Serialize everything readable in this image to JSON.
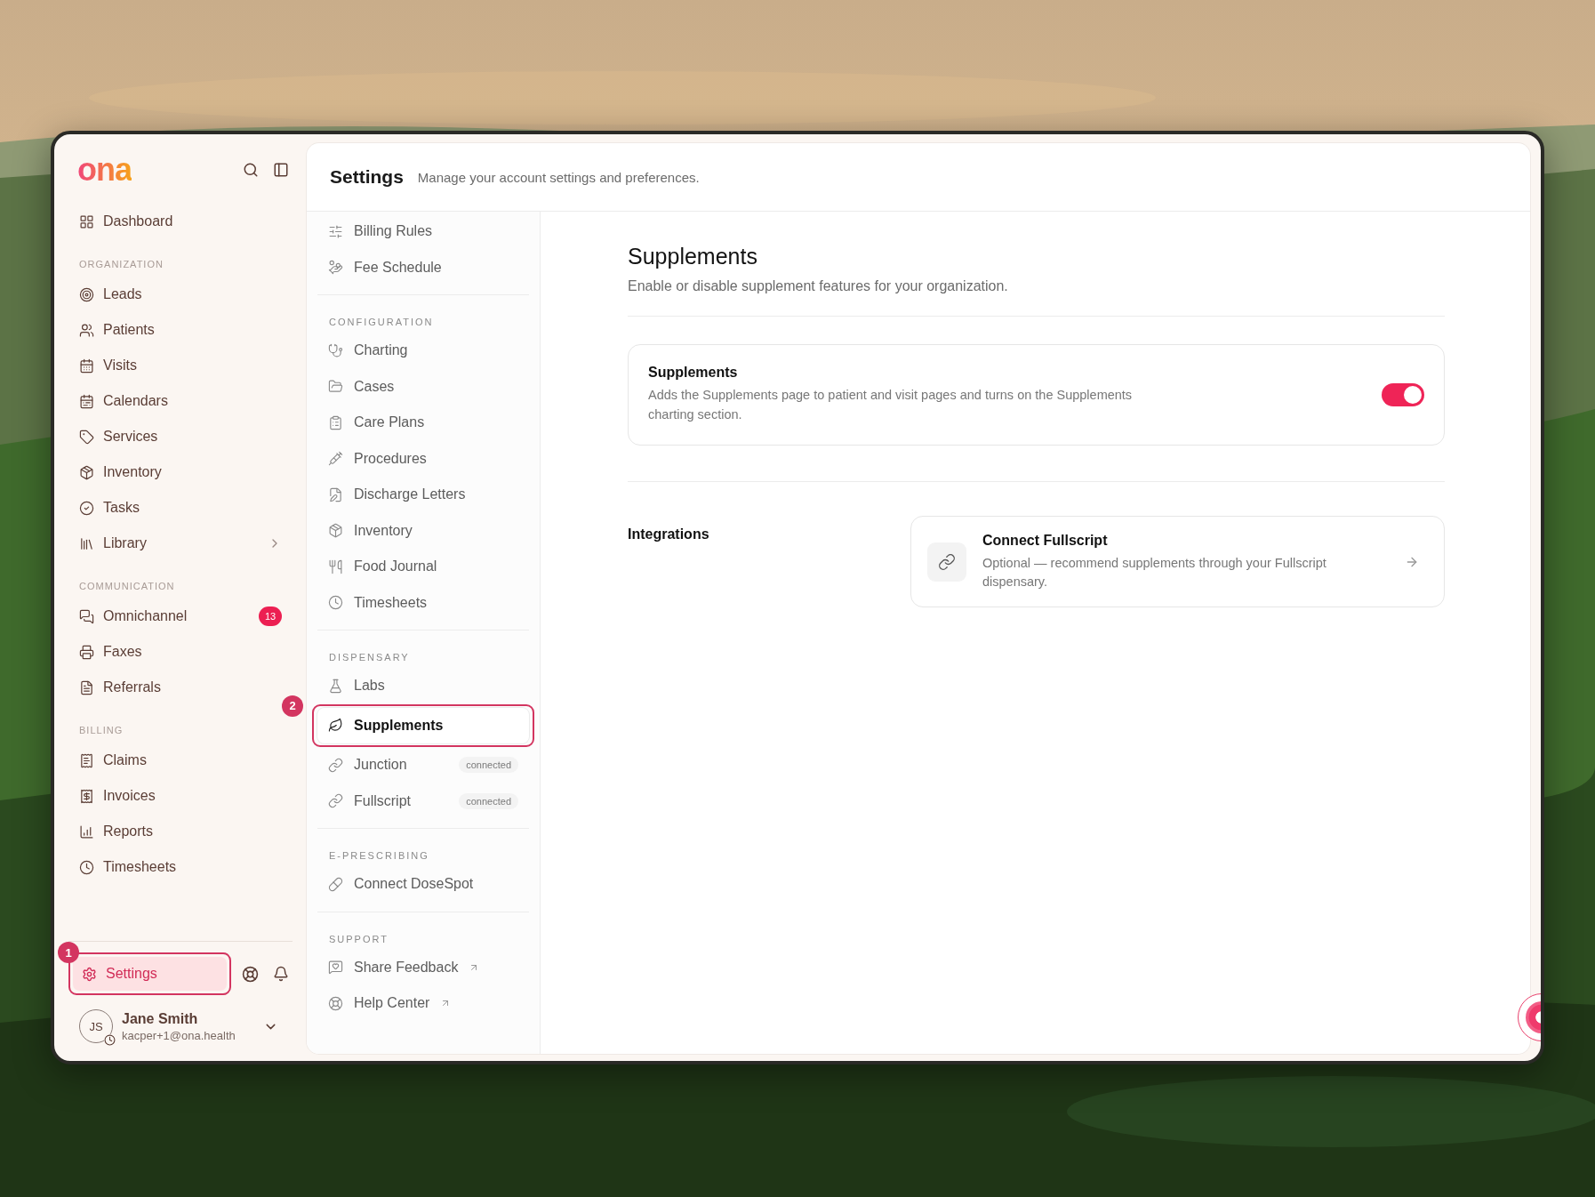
{
  "logo": "ona",
  "sidebar": {
    "top_items": [
      {
        "label": "Dashboard"
      }
    ],
    "sections": [
      {
        "heading": "ORGANIZATION",
        "items": [
          {
            "label": "Leads"
          },
          {
            "label": "Patients"
          },
          {
            "label": "Visits"
          },
          {
            "label": "Calendars"
          },
          {
            "label": "Services"
          },
          {
            "label": "Inventory"
          },
          {
            "label": "Tasks"
          },
          {
            "label": "Library",
            "expandable": true
          }
        ]
      },
      {
        "heading": "COMMUNICATION",
        "items": [
          {
            "label": "Omnichannel",
            "badge": "13"
          },
          {
            "label": "Faxes"
          },
          {
            "label": "Referrals"
          }
        ]
      },
      {
        "heading": "BILLING",
        "items": [
          {
            "label": "Claims"
          },
          {
            "label": "Invoices"
          },
          {
            "label": "Reports"
          },
          {
            "label": "Timesheets"
          }
        ]
      }
    ],
    "settings": {
      "label": "Settings",
      "selected": true,
      "callout": "1"
    },
    "user": {
      "initials": "JS",
      "name": "Jane Smith",
      "email": "kacper+1@ona.health"
    }
  },
  "header": {
    "title": "Settings",
    "subtitle": "Manage your account settings and preferences."
  },
  "settings_nav": [
    {
      "items": [
        {
          "label": "Billing Rules",
          "selected": false
        },
        {
          "label": "Fee Schedule",
          "selected": false
        }
      ]
    },
    {
      "heading": "CONFIGURATION",
      "items": [
        {
          "label": "Charting",
          "selected": false
        },
        {
          "label": "Cases",
          "selected": false
        },
        {
          "label": "Care Plans",
          "selected": false
        },
        {
          "label": "Procedures",
          "selected": false
        },
        {
          "label": "Discharge Letters",
          "selected": false
        },
        {
          "label": "Inventory",
          "selected": false
        },
        {
          "label": "Food Journal",
          "selected": false
        },
        {
          "label": "Timesheets",
          "selected": false
        }
      ]
    },
    {
      "heading": "DISPENSARY",
      "items": [
        {
          "label": "Labs",
          "selected": false
        },
        {
          "label": "Supplements",
          "selected": true,
          "callout": "2"
        },
        {
          "label": "Junction",
          "selected": false,
          "status": "connected"
        },
        {
          "label": "Fullscript",
          "selected": false,
          "status": "connected"
        }
      ]
    },
    {
      "heading": "E-PRESCRIBING",
      "items": [
        {
          "label": "Connect DoseSpot",
          "selected": false
        }
      ]
    },
    {
      "heading": "SUPPORT",
      "items": [
        {
          "label": "Share Feedback",
          "selected": false,
          "external": true
        },
        {
          "label": "Help Center",
          "selected": false,
          "external": true
        }
      ]
    }
  ],
  "content": {
    "title": "Supplements",
    "description": "Enable or disable supplement features for your organization.",
    "feature": {
      "title": "Supplements",
      "description": "Adds the Supplements page to patient and visit pages and turns on the Supplements charting section.",
      "on": true
    },
    "integrations": {
      "label": "Integrations",
      "card": {
        "title": "Connect Fullscript",
        "description": "Optional — recommend supplements through your Fullscript dispensary."
      }
    }
  }
}
